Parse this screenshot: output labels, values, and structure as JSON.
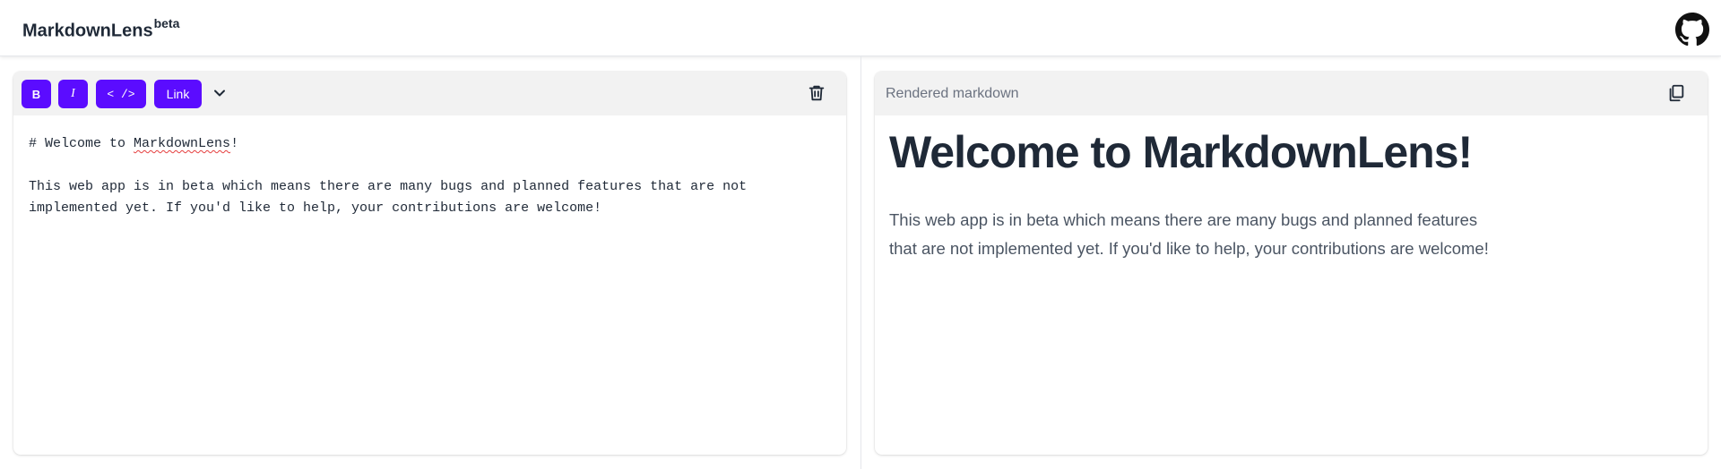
{
  "header": {
    "brand": "MarkdownLens",
    "badge": "beta",
    "github_icon": "github-icon"
  },
  "editor": {
    "toolbar": {
      "bold_label": "B",
      "italic_label": "I",
      "code_label": "< />",
      "link_label": "Link",
      "more_icon": "chevron-down-icon",
      "clear_icon": "trash-icon"
    },
    "content": {
      "line1_prefix": "# Welcome to ",
      "line1_word": "MarkdownLens",
      "line1_suffix": "!",
      "paragraph": "This web app is in beta which means there are many bugs and planned features that are not implemented yet. If you'd like to help, your contributions are welcome!"
    }
  },
  "preview": {
    "label": "Rendered markdown",
    "copy_icon": "copy-icon",
    "heading": "Welcome to MarkdownLens!",
    "paragraph_line1": "This web app is in beta which means there are many bugs and planned features",
    "paragraph_line2": "that are not implemented yet. If you'd like to help, your contributions are welcome!"
  },
  "colors": {
    "accent": "#5b0cff",
    "toolbar_bg": "#f2f2f2",
    "text": "#1f2937",
    "muted": "#6b7280"
  }
}
